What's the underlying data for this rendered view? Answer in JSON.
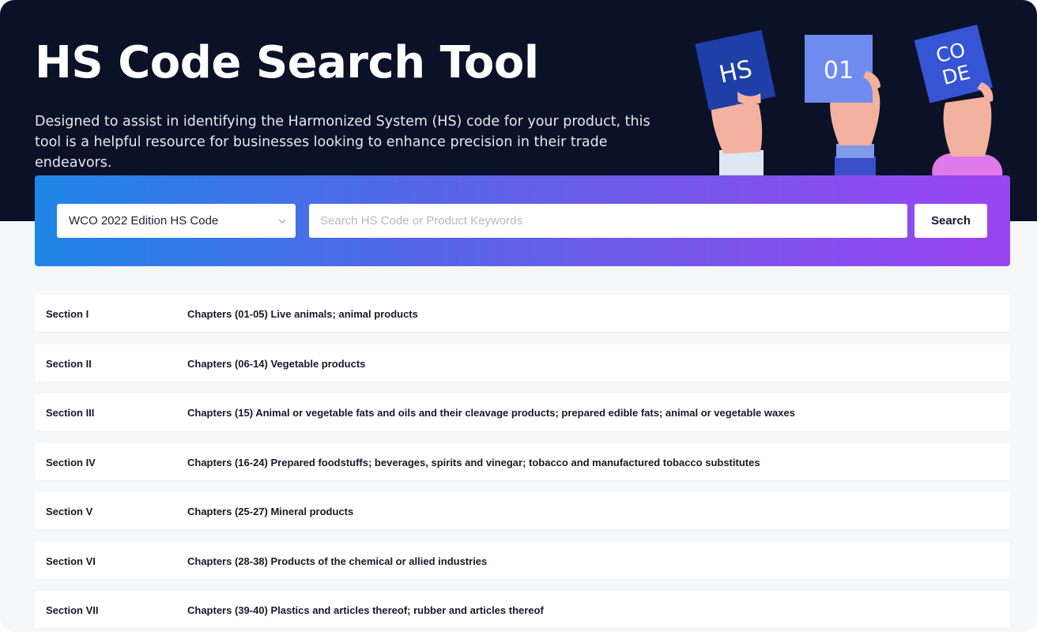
{
  "hero": {
    "title": "HS Code Search Tool",
    "description": "Designed to assist in identifying the Harmonized System (HS) code for your product, this tool is a helpful resource for businesses looking to enhance precision in their trade endeavors.",
    "cards": {
      "hs": "HS",
      "num": "01",
      "code_top": "CO",
      "code_bottom": "DE"
    }
  },
  "search": {
    "edition_selected": "WCO 2022 Edition HS Code",
    "placeholder": "Search HS Code or Product Keywords",
    "value": "",
    "button_label": "Search"
  },
  "sections": [
    {
      "section": "Section I",
      "chapters": "Chapters (01-05) Live animals; animal products"
    },
    {
      "section": "Section II",
      "chapters": "Chapters (06-14) Vegetable products"
    },
    {
      "section": "Section III",
      "chapters": "Chapters (15) Animal or vegetable fats and oils and their cleavage products; prepared edible fats; animal or vegetable waxes"
    },
    {
      "section": "Section IV",
      "chapters": "Chapters (16-24) Prepared foodstuffs; beverages, spirits and vinegar; tobacco and manufactured tobacco substitutes"
    },
    {
      "section": "Section V",
      "chapters": "Chapters (25-27) Mineral products"
    },
    {
      "section": "Section VI",
      "chapters": "Chapters (28-38) Products of the chemical or allied industries"
    },
    {
      "section": "Section VII",
      "chapters": "Chapters (39-40) Plastics and articles thereof; rubber and articles thereof"
    }
  ],
  "colors": {
    "hero_bg": "#0b1127",
    "gradient_start": "#1f86e6",
    "gradient_end": "#9a45f2",
    "card_hs": "#1e3fa8",
    "card_01": "#6f8bf0",
    "card_code": "#3555d4"
  },
  "icons": {
    "select_chevron": "chevron-down-icon"
  }
}
